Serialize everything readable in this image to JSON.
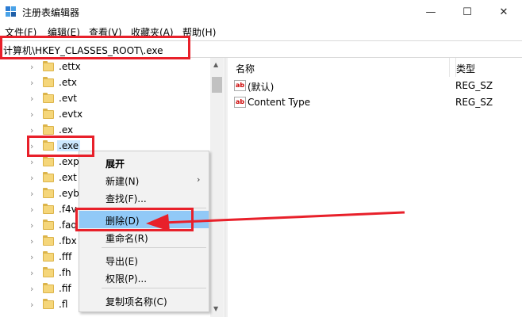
{
  "window": {
    "title": "注册表编辑器",
    "minimize_glyph": "—",
    "maximize_glyph": "☐",
    "close_glyph": "✕"
  },
  "menu": [
    "文件(F)",
    "编辑(E)",
    "查看(V)",
    "收藏夹(A)",
    "帮助(H)"
  ],
  "address": {
    "path": "计算机\\HKEY_CLASSES_ROOT\\.exe"
  },
  "tree": {
    "items": [
      ".ettx",
      ".etx",
      ".evt",
      ".evtx",
      ".ex",
      ".exe",
      ".exp",
      ".ext",
      ".eyb",
      ".f4v",
      ".faq",
      ".fbx",
      ".fff",
      ".fh",
      ".fif",
      ".fl"
    ],
    "selected": ".exe"
  },
  "values": {
    "columns": {
      "name": "名称",
      "type": "类型"
    },
    "rows": [
      {
        "name": "(默认)",
        "type": "REG_SZ",
        "icon": "string-value-icon"
      },
      {
        "name": "Content Type",
        "type": "REG_SZ",
        "icon": "string-value-icon"
      }
    ],
    "icon_text": "ab"
  },
  "context_menu": {
    "items": {
      "expand": "展开",
      "new": "新建(N)",
      "find": "查找(F)...",
      "delete": "删除(D)",
      "rename": "重命名(R)",
      "export": "导出(E)",
      "permissions": "权限(P)...",
      "copy_key_name": "复制项名称(C)"
    },
    "highlighted": "删除(D)"
  },
  "annotation": {
    "color": "#e8202a"
  }
}
